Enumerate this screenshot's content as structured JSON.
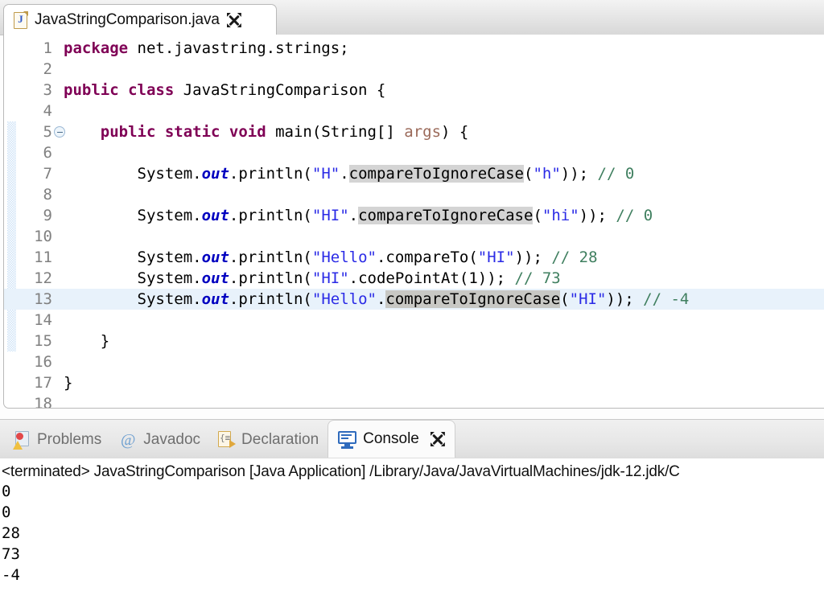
{
  "editor": {
    "tab": {
      "label": "JavaStringComparison.java",
      "file_icon": "java-file-icon",
      "close_icon": "close-icon"
    },
    "lines": [
      {
        "n": "1",
        "fold": false,
        "current": false,
        "spans": [
          {
            "t": "package ",
            "c": "kw"
          },
          {
            "t": "net.javastring.strings;",
            "c": ""
          }
        ]
      },
      {
        "n": "2",
        "fold": false,
        "current": false,
        "spans": []
      },
      {
        "n": "3",
        "fold": false,
        "current": false,
        "spans": [
          {
            "t": "public class ",
            "c": "kw"
          },
          {
            "t": "JavaStringComparison {",
            "c": ""
          }
        ]
      },
      {
        "n": "4",
        "fold": false,
        "current": false,
        "spans": []
      },
      {
        "n": "5",
        "fold": true,
        "current": false,
        "spans": [
          {
            "t": "    ",
            "c": ""
          },
          {
            "t": "public static void ",
            "c": "kw"
          },
          {
            "t": "main(String[] ",
            "c": ""
          },
          {
            "t": "args",
            "c": "par"
          },
          {
            "t": ") {",
            "c": ""
          }
        ]
      },
      {
        "n": "6",
        "fold": false,
        "current": false,
        "spans": []
      },
      {
        "n": "7",
        "fold": false,
        "current": false,
        "spans": [
          {
            "t": "        System.",
            "c": ""
          },
          {
            "t": "out",
            "c": "fld"
          },
          {
            "t": ".println(",
            "c": ""
          },
          {
            "t": "\"H\"",
            "c": "str"
          },
          {
            "t": ".",
            "c": ""
          },
          {
            "t": "compareToIgnoreCase",
            "c": "occ"
          },
          {
            "t": "(",
            "c": ""
          },
          {
            "t": "\"h\"",
            "c": "str"
          },
          {
            "t": ")); ",
            "c": ""
          },
          {
            "t": "// 0",
            "c": "cmt"
          }
        ]
      },
      {
        "n": "8",
        "fold": false,
        "current": false,
        "spans": []
      },
      {
        "n": "9",
        "fold": false,
        "current": false,
        "spans": [
          {
            "t": "        System.",
            "c": ""
          },
          {
            "t": "out",
            "c": "fld"
          },
          {
            "t": ".println(",
            "c": ""
          },
          {
            "t": "\"HI\"",
            "c": "str"
          },
          {
            "t": ".",
            "c": ""
          },
          {
            "t": "compareToIgnoreCase",
            "c": "occ"
          },
          {
            "t": "(",
            "c": ""
          },
          {
            "t": "\"hi\"",
            "c": "str"
          },
          {
            "t": ")); ",
            "c": ""
          },
          {
            "t": "// 0",
            "c": "cmt"
          }
        ]
      },
      {
        "n": "10",
        "fold": false,
        "current": false,
        "spans": []
      },
      {
        "n": "11",
        "fold": false,
        "current": false,
        "spans": [
          {
            "t": "        System.",
            "c": ""
          },
          {
            "t": "out",
            "c": "fld"
          },
          {
            "t": ".println(",
            "c": ""
          },
          {
            "t": "\"Hello\"",
            "c": "str"
          },
          {
            "t": ".compareTo(",
            "c": ""
          },
          {
            "t": "\"HI\"",
            "c": "str"
          },
          {
            "t": ")); ",
            "c": ""
          },
          {
            "t": "// 28",
            "c": "cmt"
          }
        ]
      },
      {
        "n": "12",
        "fold": false,
        "current": false,
        "spans": [
          {
            "t": "        System.",
            "c": ""
          },
          {
            "t": "out",
            "c": "fld"
          },
          {
            "t": ".println(",
            "c": ""
          },
          {
            "t": "\"HI\"",
            "c": "str"
          },
          {
            "t": ".codePointAt(1)); ",
            "c": ""
          },
          {
            "t": "// 73",
            "c": "cmt"
          }
        ]
      },
      {
        "n": "13",
        "fold": false,
        "current": true,
        "spans": [
          {
            "t": "        System.",
            "c": ""
          },
          {
            "t": "out",
            "c": "fld"
          },
          {
            "t": ".println(",
            "c": ""
          },
          {
            "t": "\"Hello\"",
            "c": "str"
          },
          {
            "t": ".",
            "c": ""
          },
          {
            "t": "compare",
            "c": "occ-strong"
          },
          {
            "t": "|",
            "c": "caret"
          },
          {
            "t": "ToIgnoreCase",
            "c": "occ-strong"
          },
          {
            "t": "(",
            "c": ""
          },
          {
            "t": "\"HI\"",
            "c": "str"
          },
          {
            "t": ")); ",
            "c": ""
          },
          {
            "t": "// -4",
            "c": "cmt"
          }
        ]
      },
      {
        "n": "14",
        "fold": false,
        "current": false,
        "spans": []
      },
      {
        "n": "15",
        "fold": false,
        "current": false,
        "spans": [
          {
            "t": "    }",
            "c": ""
          }
        ]
      },
      {
        "n": "16",
        "fold": false,
        "current": false,
        "spans": []
      },
      {
        "n": "17",
        "fold": false,
        "current": false,
        "spans": [
          {
            "t": "}",
            "c": ""
          }
        ]
      },
      {
        "n": "18",
        "fold": false,
        "current": false,
        "spans": []
      }
    ]
  },
  "bottom_panel": {
    "tabs": [
      {
        "label": "Problems",
        "icon": "problems-icon",
        "active": false,
        "closable": false
      },
      {
        "label": "Javadoc",
        "icon": "javadoc-icon",
        "active": false,
        "closable": false
      },
      {
        "label": "Declaration",
        "icon": "declaration-icon",
        "active": false,
        "closable": false
      },
      {
        "label": "Console",
        "icon": "console-icon",
        "active": true,
        "closable": true
      }
    ],
    "console": {
      "header": "<terminated> JavaStringComparison [Java Application] /Library/Java/JavaVirtualMachines/jdk-12.jdk/C",
      "output": [
        "0",
        "0",
        "28",
        "73",
        "-4"
      ]
    }
  },
  "colors": {
    "keyword": "#7f0055",
    "string": "#2a2ae6",
    "comment": "#3f7f5f",
    "field": "#0000c0",
    "parameter": "#9b6a5a",
    "occurrence_highlight": "#d4d4d4",
    "current_line": "#e8f2fb",
    "fold_bar": "#cfe3f7"
  }
}
